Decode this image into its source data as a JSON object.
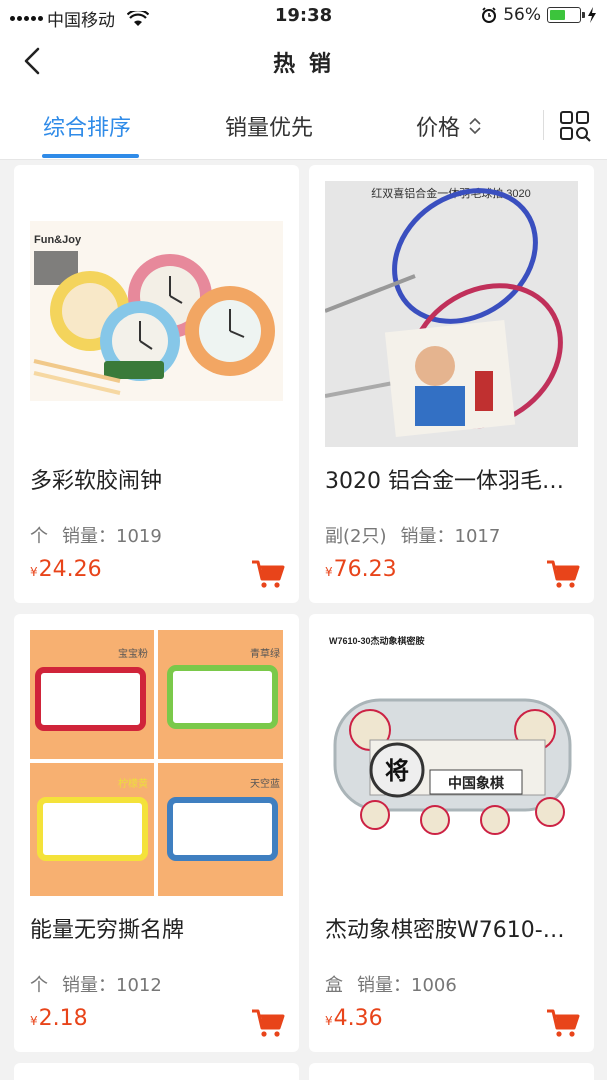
{
  "status_bar": {
    "carrier": "中国移动",
    "time": "19:38",
    "battery_text": "56%",
    "battery_level": 0.56
  },
  "nav": {
    "title": "热 销"
  },
  "tabs": {
    "items": [
      "综合排序",
      "销量优先",
      "价格"
    ],
    "active_index": 0
  },
  "products": [
    {
      "name": "多彩软胶闹钟",
      "unit": "个",
      "sales_label": "销量：",
      "sales": "1019",
      "currency": "¥",
      "price": "24.26",
      "image_text": "Fun&Joy"
    },
    {
      "name": "3020 铝合金一体羽毛…",
      "unit": "副(2只)",
      "sales_label": "销量：",
      "sales": "1017",
      "currency": "¥",
      "price": "76.23",
      "image_text": "红双喜铝合金一体羽毛球拍 3020"
    },
    {
      "name": "能量无穷撕名牌",
      "unit": "个",
      "sales_label": "销量：",
      "sales": "1012",
      "currency": "¥",
      "price": "2.18",
      "image_labels": [
        "宝宝粉",
        "青草绿",
        "柠檬黄",
        "天空蓝"
      ]
    },
    {
      "name": "杰动象棋密胺W7610-…",
      "unit": "盒",
      "sales_label": "销量：",
      "sales": "1006",
      "currency": "¥",
      "price": "4.36",
      "image_text": "W7610-30杰动象棋密胺",
      "box_text": "中国象棋",
      "piece_text": "将"
    }
  ],
  "colors": {
    "accent": "#2f8be8",
    "price": "#e8441a",
    "background": "#f2f2f2"
  }
}
